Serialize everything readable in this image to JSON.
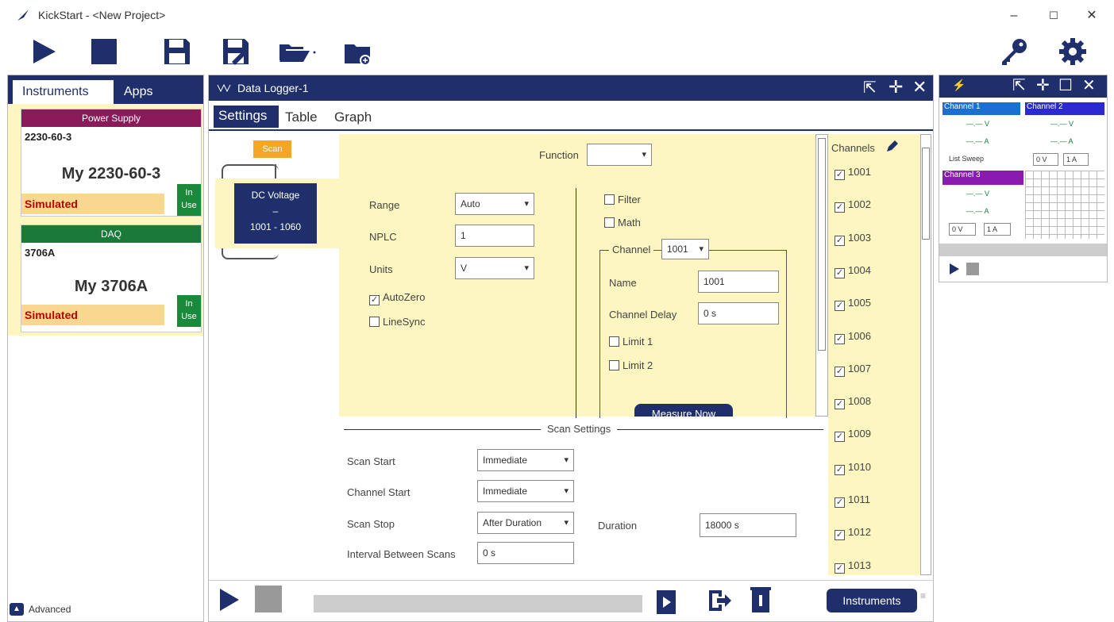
{
  "window": {
    "title": "KickStart - <New Project>",
    "min": "–",
    "max": "☐",
    "close": "✕"
  },
  "toolbar": {
    "run": "run-icon",
    "stop": "stop-icon",
    "save": "save-icon",
    "save_as": "save-as-icon",
    "open": "open-icon",
    "new_folder": "new-folder-icon",
    "key": "key-icon",
    "settings": "gear-icon"
  },
  "left": {
    "tab_instruments": "Instruments",
    "tab_apps": "Apps",
    "cards": [
      {
        "header": "Power Supply",
        "model": "2230-60-3",
        "nickname": "My 2230-60-3",
        "status": "Simulated",
        "in_use": "In Use",
        "color": "#8b1a5a"
      },
      {
        "header": "DAQ",
        "model": "3706A",
        "nickname": "My 3706A",
        "status": "Simulated",
        "in_use": "In Use",
        "color": "#1a7a3a"
      }
    ],
    "advanced": "Advanced"
  },
  "logger": {
    "title": "Data Logger-1",
    "tabs": [
      "Settings",
      "Table",
      "Graph"
    ],
    "scan_label": "Scan",
    "block_title": "DC Voltage",
    "block_dash": "–",
    "block_range": "1001 - 1060",
    "function_label": "Function",
    "function_value": "",
    "range_label": "Range",
    "range_value": "Auto",
    "nplc_label": "NPLC",
    "nplc_value": "1",
    "units_label": "Units",
    "units_value": "V",
    "autozero": "AutoZero",
    "linesync": "LineSync",
    "filter": "Filter",
    "math": "Math",
    "channel_label": "Channel",
    "channel_value": "1001",
    "name_label": "Name",
    "name_value": "1001",
    "delay_label": "Channel Delay",
    "delay_value": "0 s",
    "limit1": "Limit 1",
    "limit2": "Limit 2",
    "measure_now": "Measure Now",
    "scan_settings": "Scan Settings",
    "scan_start_label": "Scan Start",
    "scan_start": "Immediate",
    "channel_start_label": "Channel Start",
    "channel_start": "Immediate",
    "scan_stop_label": "Scan Stop",
    "scan_stop": "After Duration",
    "duration_label": "Duration",
    "duration": "18000 s",
    "interval_label": "Interval Between Scans",
    "interval": "0 s",
    "channels_label": "Channels",
    "channels": [
      "1001",
      "1002",
      "1003",
      "1004",
      "1005",
      "1006",
      "1007",
      "1008",
      "1009",
      "1010",
      "1011",
      "1012",
      "1013"
    ],
    "instruments_button": "Instruments"
  },
  "right": {
    "ch1": "Channel 1",
    "ch2": "Channel 2",
    "ch3": "Channel 3",
    "v": "V",
    "a": "A",
    "dash": "—.—",
    "list_sweep": "List Sweep",
    "zero_v": "0 V",
    "one_a": "1 A"
  }
}
